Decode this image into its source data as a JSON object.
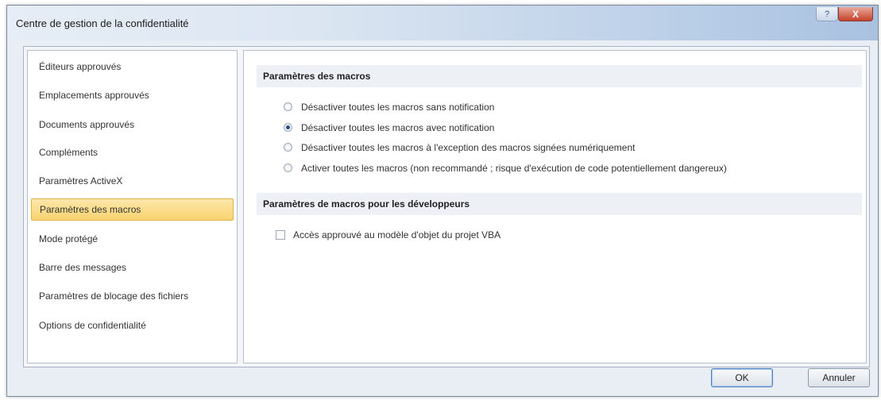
{
  "window": {
    "title": "Centre de gestion de la confidentialité",
    "help_label": "?",
    "close_label": "X"
  },
  "sidebar": {
    "items": [
      {
        "label": "Éditeurs approuvés",
        "selected": false
      },
      {
        "label": "Emplacements approuvés",
        "selected": false
      },
      {
        "label": "Documents approuvés",
        "selected": false
      },
      {
        "label": "Compléments",
        "selected": false
      },
      {
        "label": "Paramètres ActiveX",
        "selected": false
      },
      {
        "label": "Paramètres des macros",
        "selected": true
      },
      {
        "label": "Mode protégé",
        "selected": false
      },
      {
        "label": "Barre des messages",
        "selected": false
      },
      {
        "label": "Paramètres de blocage des fichiers",
        "selected": false
      },
      {
        "label": "Options de confidentialité",
        "selected": false
      }
    ]
  },
  "macro_settings": {
    "header": "Paramètres des macros",
    "options": [
      {
        "label": "Désactiver toutes les macros sans notification",
        "checked": false
      },
      {
        "label": "Désactiver toutes les macros avec notification",
        "checked": true
      },
      {
        "label": "Désactiver toutes les macros à l'exception des macros signées numériquement",
        "checked": false
      },
      {
        "label": "Activer toutes les macros (non recommandé ; risque d'exécution de code potentiellement dangereux)",
        "checked": false
      }
    ]
  },
  "developer_settings": {
    "header": "Paramètres de macros pour les développeurs",
    "vba_access": {
      "label": "Accès approuvé au modèle d'objet du projet VBA",
      "checked": false
    }
  },
  "buttons": {
    "ok": "OK",
    "cancel": "Annuler"
  }
}
